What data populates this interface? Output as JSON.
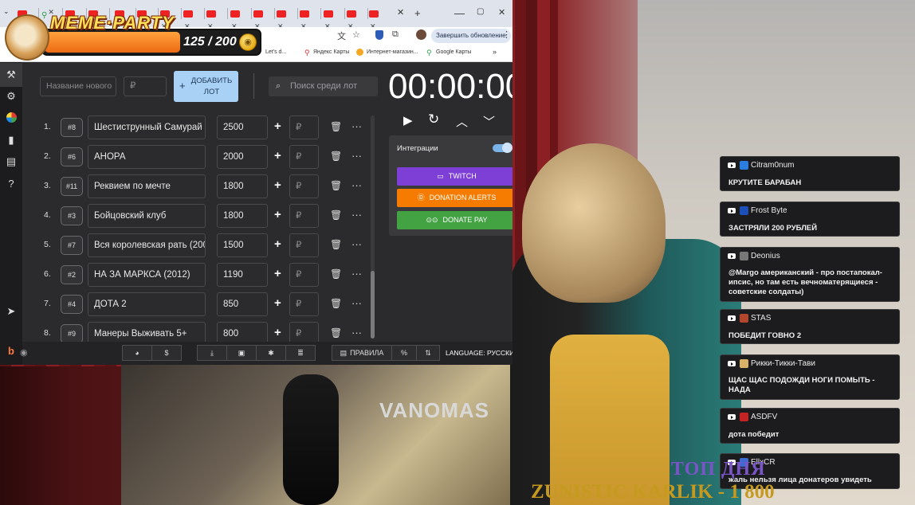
{
  "meme_party": {
    "title": "MEME·PARTY",
    "count": "125 / 200",
    "progress": 0.625
  },
  "browser": {
    "update_button": "Завершить обновление",
    "bookmarks": [
      "Let's d...",
      "Яндекс Карты",
      "Интернет-магазин...",
      "Google Карты"
    ]
  },
  "app": {
    "new_name_placeholder": "Название нового",
    "currency_symbol": "₽",
    "add_button": "ДОБАВИТЬ ЛОТ",
    "search_placeholder": "Поиск среди лот",
    "timer": "00:00:00",
    "lots": [
      {
        "num": "1.",
        "id": "#8",
        "name": "Шестиструнный Самурай",
        "amount": "2500"
      },
      {
        "num": "2.",
        "id": "#6",
        "name": "АНОРА",
        "amount": "2000"
      },
      {
        "num": "3.",
        "id": "#11",
        "name": "Реквием по мечте",
        "amount": "1800"
      },
      {
        "num": "4.",
        "id": "#3",
        "name": "Бойцовский клуб",
        "amount": "1800"
      },
      {
        "num": "5.",
        "id": "#7",
        "name": "Вся королевская рать (200",
        "amount": "1500"
      },
      {
        "num": "6.",
        "id": "#2",
        "name": " НА ЗА МАРКСА (2012)",
        "amount": "1190"
      },
      {
        "num": "7.",
        "id": "#4",
        "name": "ДОТА 2",
        "amount": "850"
      },
      {
        "num": "8.",
        "id": "#9",
        "name": "Манеры Выживать 5+",
        "amount": "800"
      }
    ],
    "integrations": {
      "label": "Интеграции",
      "enabled": true,
      "buttons": [
        {
          "label": "TWITCH",
          "color": "#7d3fd6"
        },
        {
          "label": "DONATION ALERTS",
          "color": "#f57c00"
        },
        {
          "label": "DONATE PAY",
          "color": "#43a343"
        }
      ]
    },
    "bottom": {
      "rules": "ПРАВИЛА",
      "percent": "%",
      "language": "LANGUAGE: РУССКИ"
    }
  },
  "chat": [
    {
      "user": "Citram0num",
      "avatar_color": "#2a7de1",
      "msg": "КРУТИТЕ БАРАБАН"
    },
    {
      "user": "Frost Byte",
      "avatar_color": "#1d4fb8",
      "msg": "ЗАСТРЯЛИ 200 РУБЛЕЙ"
    },
    {
      "user": "Deonius",
      "avatar_color": "#777777",
      "msg": "@Margo американский - про постапокал-ипсис, но там есть вечноматерящиеся - советские солдаты)"
    },
    {
      "user": "STAS",
      "avatar_color": "#b3462d",
      "msg": "ПОБЕДИТ ГОВНО 2"
    },
    {
      "user": "Рикки-Тикки-Тави",
      "avatar_color": "#d9b26a",
      "msg": "ЩАС ЩАС ПОДОЖДИ НОГИ ПОМЫТЬ - НАДА"
    },
    {
      "user": "ASDFV",
      "avatar_color": "#c42323",
      "msg": "дота победит"
    },
    {
      "user": "EllxCR",
      "avatar_color": "#3d6bd1",
      "msg": "жаль нельзя лица донатеров увидеть"
    }
  ],
  "stream": {
    "banner": "VANOMAS",
    "toplist_title": "ТОП ДНЯ",
    "top_line": "ZUNISTIC KARLIK - 1 800"
  }
}
